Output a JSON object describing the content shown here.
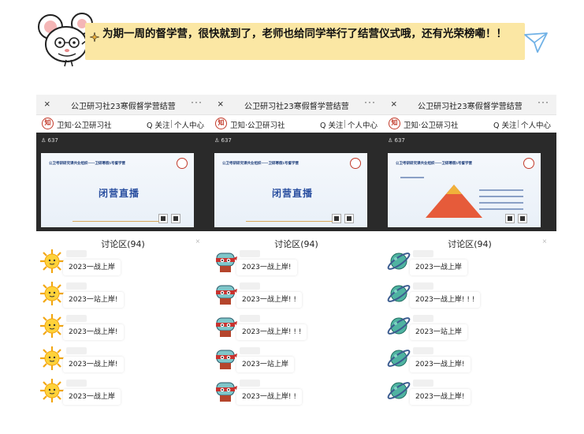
{
  "banner": {
    "text": "为期一周的督学营，很快就到了，老师也给同学举行了结营仪式哦，还有光荣榜嘞！！"
  },
  "panels": [
    {
      "title": "公卫研习社23寒假督学营结营",
      "more": "···",
      "close": "×",
      "logo": "知",
      "channel": "卫知·公卫研习社",
      "follow": "Q 关注",
      "center": "个人中心",
      "viewers": "637",
      "slide": {
        "title": "公卫考研研究课共业组织——卫研寒假1号督学营",
        "main": "闭营直播"
      },
      "chat_title": "讨论区(94)",
      "chat_close": "×",
      "avatar": "sun-avatar",
      "messages": [
        "2023一战上岸",
        "2023一站上岸!",
        "2023一战上岸!",
        "2023一战上岸!",
        "2023一战上岸"
      ]
    },
    {
      "title": "公卫研习社23寒假督学营结营",
      "more": "···",
      "close": "×",
      "logo": "知",
      "channel": "卫知·公卫研习社",
      "follow": "Q 关注",
      "center": "个人中心",
      "viewers": "637",
      "slide": {
        "title": "公卫考研研究课共业组织——卫研寒假1号督学营",
        "main": "闭营直播"
      },
      "chat_title": "讨论区(94)",
      "chat_close": "×",
      "avatar": "robot-avatar",
      "messages": [
        "2023一战上岸!",
        "2023一战上岸! !",
        "2023一战上岸! ! !",
        "2023一站上岸",
        "2023一战上岸! !"
      ]
    },
    {
      "title": "公卫研习社23寒假督学营结营",
      "more": "···",
      "close": "×",
      "logo": "知",
      "channel": "卫知·公卫研习社",
      "follow": "Q 关注",
      "center": "个人中心",
      "viewers": "637",
      "slide": {
        "title": "公卫考研研究课共业组织——卫研寒假1号督学营"
      },
      "chat_title": "讨论区(94)",
      "chat_close": "×",
      "avatar": "planet-avatar",
      "messages": [
        "2023一战上岸",
        "2023一战上岸! ! !",
        "2023一站上岸",
        "2023一战上岸!",
        "2023一战上岸!"
      ]
    }
  ],
  "colors": {
    "banner_bg": "#fbe7a4",
    "brand_red": "#c23a2a",
    "slide_blue": "#2a4fa0"
  }
}
